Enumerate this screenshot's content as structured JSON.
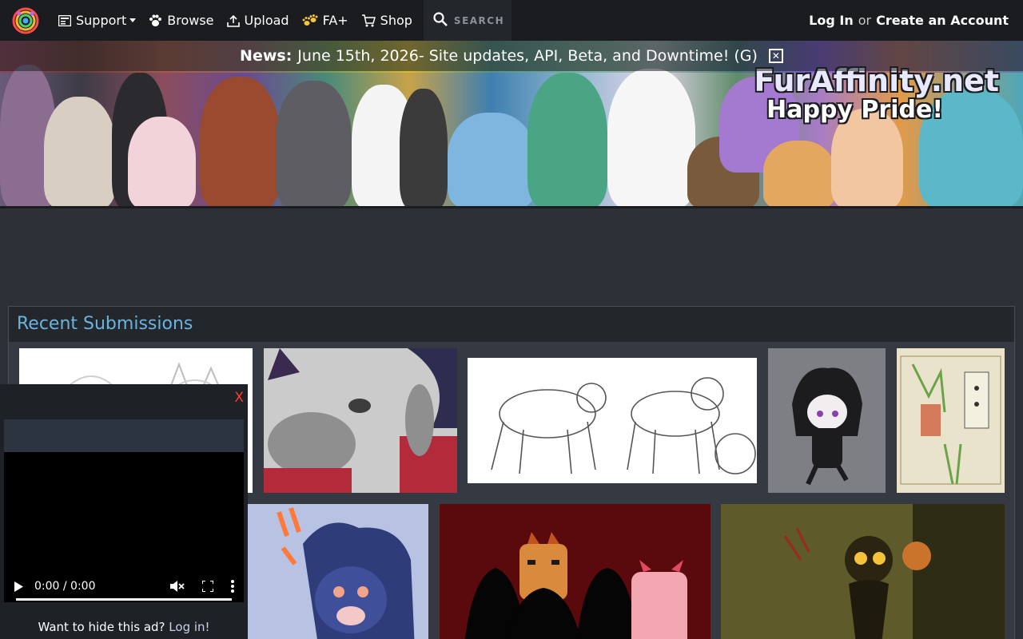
{
  "nav": {
    "logo_icon": "paw-rainbow-logo-icon",
    "support": "Support",
    "browse": "Browse",
    "upload": "Upload",
    "faplus": "FA+",
    "shop": "Shop",
    "search_placeholder": "SEARCH",
    "login": "Log In",
    "or": "or",
    "create_account": "Create an Account"
  },
  "banner": {
    "site_name": "FurAffinity.net",
    "tagline": "Happy Pride!"
  },
  "news": {
    "label": "News:",
    "text": "June 15th, 2026- Site updates, API, Beta, and Downtime! (G)",
    "close_glyph": "✕"
  },
  "section": {
    "title": "Recent Submissions"
  },
  "video_ad": {
    "close_label": "X",
    "time": "0:00 / 0:00",
    "hint_text": "Want to hide this ad?",
    "hint_link": "Log in!"
  },
  "colors": {
    "nav_bg": "#1a1c20",
    "page_bg": "#2d3036",
    "section_title": "#6ab4e0",
    "ad_close": "#ff3b30"
  }
}
